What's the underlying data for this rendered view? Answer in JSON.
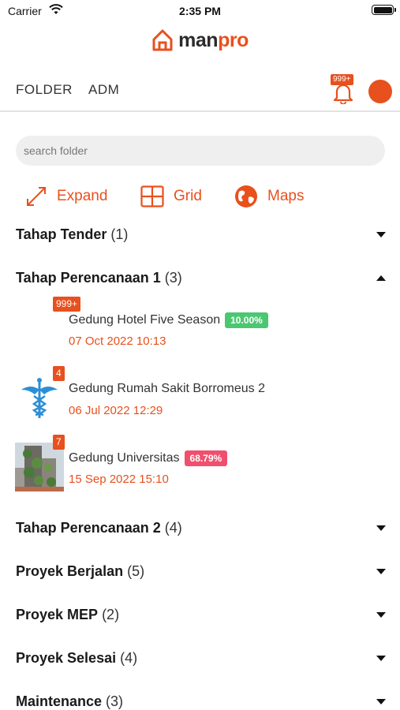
{
  "status_bar": {
    "carrier": "Carrier",
    "time": "2:35 PM"
  },
  "app": {
    "logo_part1": "man",
    "logo_part2": "pro"
  },
  "nav": {
    "tabs": [
      {
        "label": "FOLDER"
      },
      {
        "label": "ADM"
      }
    ],
    "notification_badge": "999+"
  },
  "search": {
    "placeholder": "search folder",
    "value": ""
  },
  "view_options": [
    {
      "label": "Expand",
      "icon": "expand-icon"
    },
    {
      "label": "Grid",
      "icon": "grid-icon"
    },
    {
      "label": "Maps",
      "icon": "globe-icon"
    }
  ],
  "sections": [
    {
      "title": "Tahap Tender",
      "count": "(1)",
      "expanded": false
    },
    {
      "title": "Tahap Perencanaan 1",
      "count": "(3)",
      "expanded": true,
      "items": [
        {
          "badge": "999+",
          "name": "Gedung Hotel Five Season",
          "progress": "10.00%",
          "progress_color": "#4cc771",
          "date": "07 Oct 2022 10:13",
          "thumb": "none"
        },
        {
          "badge": "4",
          "name": "Gedung Rumah Sakit Borromeus 2",
          "progress": "",
          "date": "06 Jul 2022 12:29",
          "thumb": "caduceus-icon"
        },
        {
          "badge": "7",
          "name": "Gedung Universitas",
          "progress": "68.79%",
          "progress_color": "#f0506e",
          "date": "15 Sep 2022 15:10",
          "thumb": "building-photo"
        }
      ]
    },
    {
      "title": "Tahap Perencanaan 2",
      "count": "(4)",
      "expanded": false
    },
    {
      "title": "Proyek Berjalan",
      "count": "(5)",
      "expanded": false
    },
    {
      "title": "Proyek MEP",
      "count": "(2)",
      "expanded": false
    },
    {
      "title": "Proyek Selesai",
      "count": "(4)",
      "expanded": false
    },
    {
      "title": "Maintenance",
      "count": "(3)",
      "expanded": false
    }
  ],
  "colors": {
    "accent": "#e8501d",
    "text": "#1a1a1a"
  }
}
